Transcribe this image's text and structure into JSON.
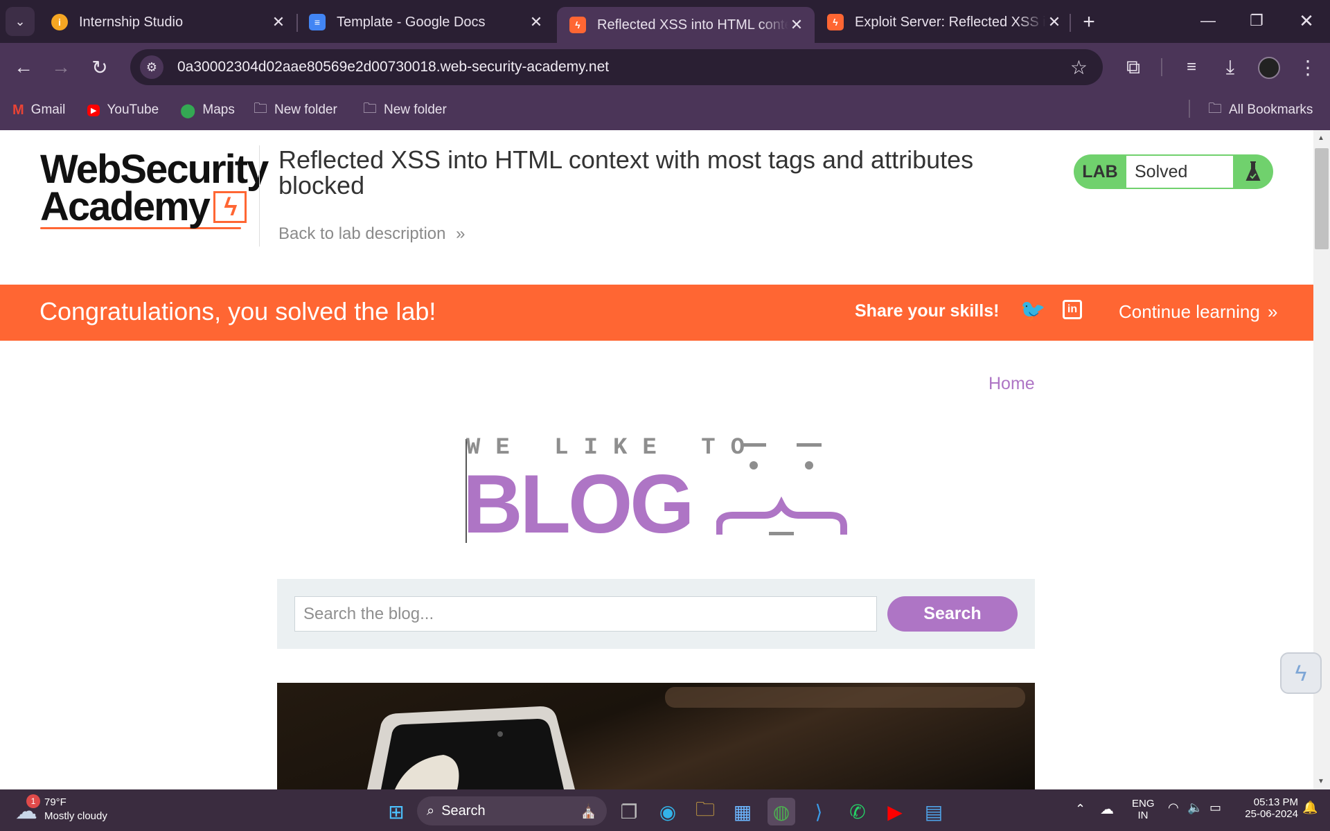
{
  "browser": {
    "tabs": [
      {
        "title": "Internship Studio",
        "favicon": "info-icon",
        "color": "#f5a623"
      },
      {
        "title": "Template - Google Docs",
        "favicon": "docs-icon",
        "color": "#4285f4"
      },
      {
        "title": "Reflected XSS into HTML context with most tags and attributes blocked",
        "favicon": "portswigger-icon",
        "color": "#ff6633",
        "active": true
      },
      {
        "title": "Exploit Server: Reflected XSS into HTML context",
        "favicon": "portswigger-icon",
        "color": "#ff6633"
      }
    ],
    "new_tab_label": "+",
    "url": "0a30002304d02aae80569e2d00730018.web-security-academy.net",
    "bookmarks": [
      {
        "label": "Gmail",
        "icon": "gmail-icon"
      },
      {
        "label": "YouTube",
        "icon": "youtube-icon"
      },
      {
        "label": "Maps",
        "icon": "maps-icon"
      },
      {
        "label": "New folder",
        "icon": "folder-icon"
      },
      {
        "label": "New folder",
        "icon": "folder-icon"
      }
    ],
    "all_bookmarks_label": "All Bookmarks"
  },
  "header": {
    "logo_line1": "WebSecurity",
    "logo_line2": "Academy",
    "lab_title": "Reflected XSS into HTML context with most tags and attributes blocked",
    "back_link": "Back to lab description",
    "back_chevron": "»",
    "badge_label": "LAB",
    "badge_status": "Solved"
  },
  "banner": {
    "congrats": "Congratulations, you solved the lab!",
    "share": "Share your skills!",
    "continue": "Continue learning",
    "continue_chevron": "»"
  },
  "blog": {
    "nav_home": "Home",
    "tagline": "WE LIKE TO",
    "title": "BLOG",
    "search_placeholder": "Search the blog...",
    "search_button": "Search"
  },
  "taskbar": {
    "weather_temp": "79°F",
    "weather_desc": "Mostly cloudy",
    "weather_badge": "1",
    "search_label": "Search",
    "lang_line1": "ENG",
    "lang_line2": "IN",
    "time": "05:13 PM",
    "date": "25-06-2024"
  },
  "colors": {
    "accent_orange": "#ff6633",
    "blog_purple": "#ae75c5",
    "lab_green": "#70d16d"
  }
}
